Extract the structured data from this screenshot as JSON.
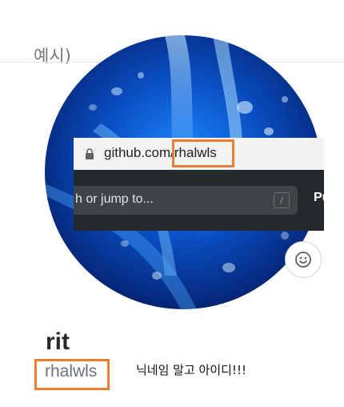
{
  "example_label": "예시)",
  "browser": {
    "url_domain": "github.com",
    "url_path": "/rhalwls",
    "search_placeholder": "h or jump to...",
    "slash_key": "/",
    "nav_pull": "Pull"
  },
  "profile": {
    "display_name": "rit",
    "username": "rhalwls",
    "emoji_icon": "smiley-icon"
  },
  "annotation": "닉네임 말고 아이디!!!",
  "colors": {
    "highlight": "#ed7d31",
    "github_header": "#24292e"
  }
}
